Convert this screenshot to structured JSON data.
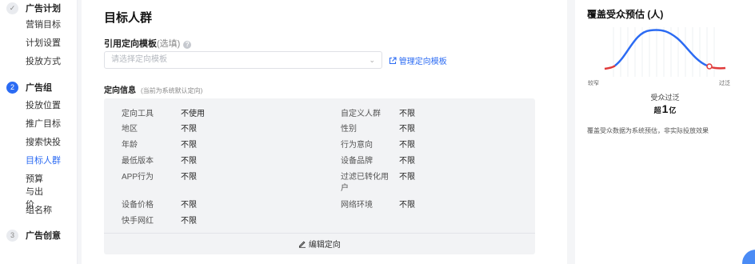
{
  "sidebar": {
    "steps": [
      {
        "num": "✓",
        "label": "广告计划"
      },
      {
        "num": "2",
        "label": "广告组"
      },
      {
        "num": "3",
        "label": "广告创意"
      }
    ],
    "step1_items": [
      "营销目标",
      "计划设置",
      "投放方式"
    ],
    "step2_items": [
      "投放位置",
      "推广目标",
      "搜索快投",
      "目标人群",
      "预算与出价",
      "组名称"
    ]
  },
  "main": {
    "title": "目标人群",
    "template_label": "引用定向模板",
    "template_optional": "(选填)",
    "template_placeholder": "请选择定向模板",
    "manage_link": "管理定向模板",
    "targeting_label": "定向信息",
    "targeting_hint": "(当前为系统默认定向)",
    "left_rows": [
      {
        "name": "定向工具",
        "value": "不使用"
      },
      {
        "name": "地区",
        "value": "不限"
      },
      {
        "name": "年龄",
        "value": "不限"
      },
      {
        "name": "最低版本",
        "value": "不限"
      },
      {
        "name": "APP行为",
        "value": "不限"
      },
      {
        "name": "设备价格",
        "value": "不限"
      },
      {
        "name": "快手网红",
        "value": "不限"
      }
    ],
    "right_rows": [
      {
        "name": "自定义人群",
        "value": "不限"
      },
      {
        "name": "性别",
        "value": "不限"
      },
      {
        "name": "行为意向",
        "value": "不限"
      },
      {
        "name": "设备品牌",
        "value": "不限"
      },
      {
        "name": "过滤已转化用户",
        "value": "不限"
      },
      {
        "name": "网络环境",
        "value": "不限"
      }
    ],
    "edit_label": "编辑定向"
  },
  "estimate": {
    "title": "覆盖受众预估 (人)",
    "left_label": "较窄",
    "right_label": "过泛",
    "status": "受众过泛",
    "prefix": "超",
    "number": "1",
    "unit": "亿",
    "note": "覆盖受众数据为系统预估，非实际投放效果",
    "colors": {
      "narrow": "#e03a3a",
      "ideal": "#2b6bf3",
      "marker": "#e03a3a"
    }
  }
}
